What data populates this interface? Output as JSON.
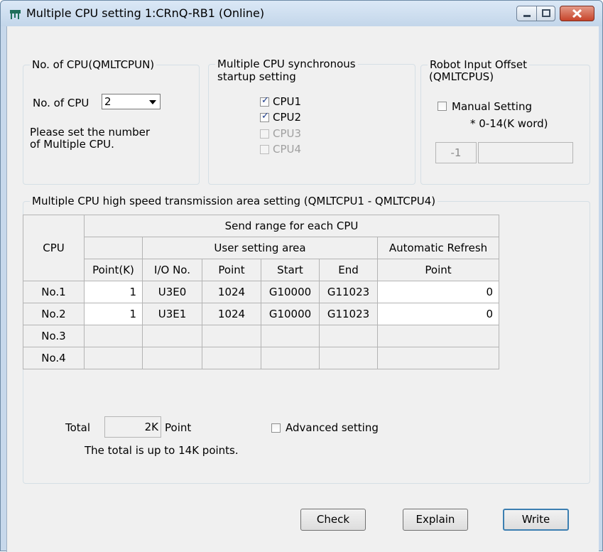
{
  "window": {
    "title": "Multiple CPU setting 1:CRnQ-RB1 (Online)",
    "buttons": {
      "minimize": "minimize",
      "maximize": "maximize",
      "close": "close"
    }
  },
  "num_cpu": {
    "legend": "No. of CPU(QMLTCPUN)",
    "label": "No. of CPU",
    "selected": "2",
    "hint_line1": "Please set the number",
    "hint_line2": "of Multiple CPU."
  },
  "sync": {
    "legend_line1": "Multiple CPU synchronous",
    "legend_line2": "startup setting",
    "items": [
      {
        "label": "CPU1",
        "checked": true,
        "enabled": true
      },
      {
        "label": "CPU2",
        "checked": true,
        "enabled": true
      },
      {
        "label": "CPU3",
        "checked": false,
        "enabled": false
      },
      {
        "label": "CPU4",
        "checked": false,
        "enabled": false
      }
    ]
  },
  "robot": {
    "legend_line1": "Robot Input Offset",
    "legend_line2": "(QMLTCPUS)",
    "manual_label": "Manual Setting",
    "range_note": "* 0-14(K word)",
    "offset_value": "-1",
    "value": ""
  },
  "transmission": {
    "legend": "Multiple CPU high speed transmission area setting (QMLTCPU1 - QMLTCPU4)",
    "headers": {
      "cpu": "CPU",
      "send_range": "Send range for each CPU",
      "user_area": "User setting area",
      "auto_refresh": "Automatic Refresh",
      "point_k": "Point(K)",
      "io_no": "I/O No.",
      "point": "Point",
      "start": "Start",
      "end": "End",
      "ar_point": "Point"
    },
    "rows": [
      {
        "cpu": "No.1",
        "point_k": "1",
        "io": "U3E0",
        "point": "1024",
        "start": "G10000",
        "end": "G11023",
        "ar_point": "0"
      },
      {
        "cpu": "No.2",
        "point_k": "1",
        "io": "U3E1",
        "point": "1024",
        "start": "G10000",
        "end": "G11023",
        "ar_point": "0"
      },
      {
        "cpu": "No.3",
        "point_k": "",
        "io": "",
        "point": "",
        "start": "",
        "end": "",
        "ar_point": ""
      },
      {
        "cpu": "No.4",
        "point_k": "",
        "io": "",
        "point": "",
        "start": "",
        "end": "",
        "ar_point": ""
      }
    ],
    "total_label": "Total",
    "total_value": "2K",
    "total_unit": "Point",
    "advanced_label": "Advanced setting",
    "total_note": "The total is up to 14K points."
  },
  "footer": {
    "check": "Check",
    "explain": "Explain",
    "write": "Write"
  }
}
